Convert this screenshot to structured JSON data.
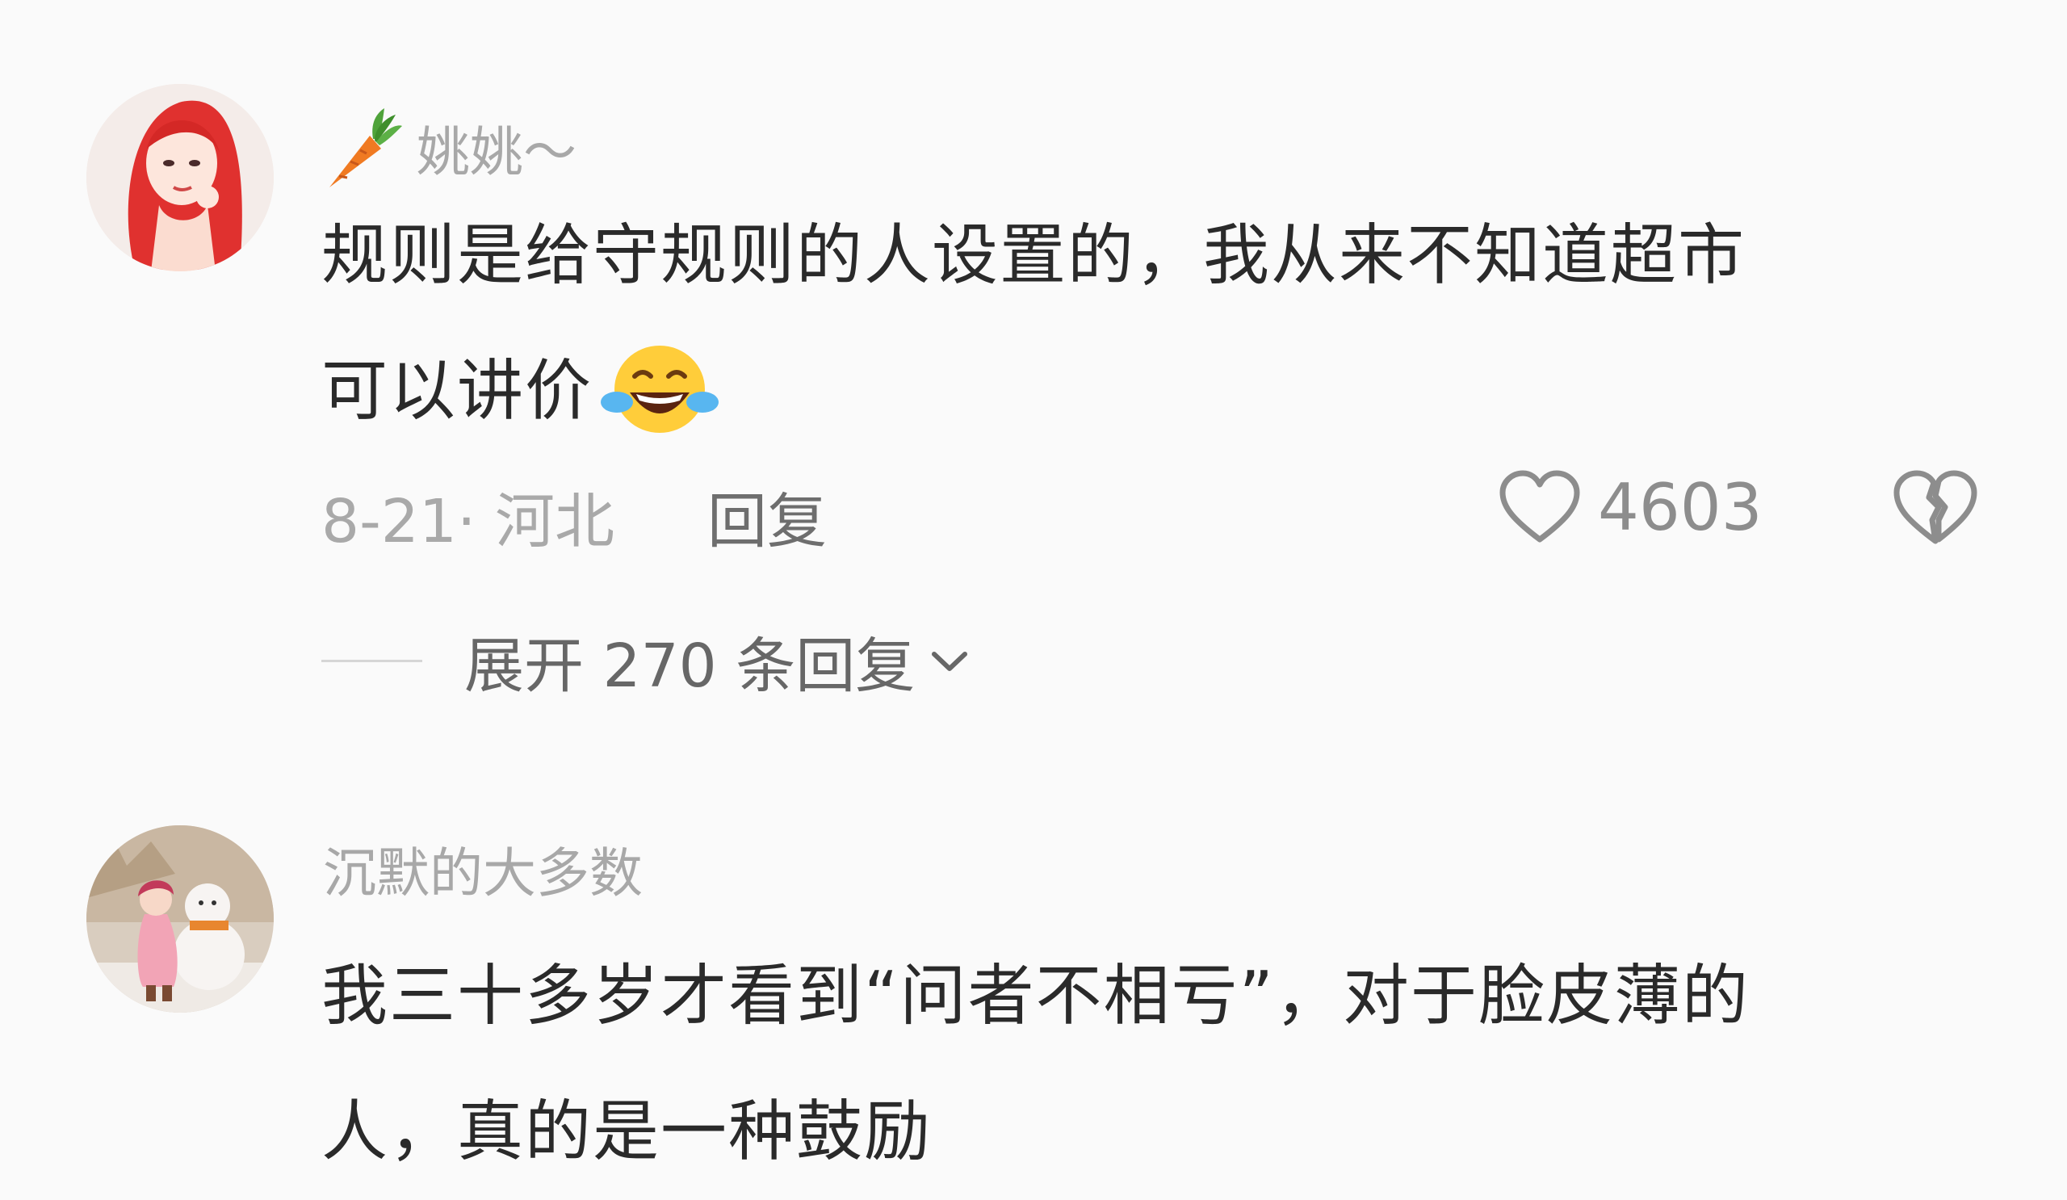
{
  "comments": [
    {
      "username": "姚姚～",
      "content_line1": "规则是给守规则的人设置的，我从来不知道超市",
      "content_line2": "可以讲价",
      "date_location": "8-21· 河北",
      "reply_label": "回复",
      "likes": "4603",
      "expand_label": "展开 270 条回复",
      "icons": [
        "carrot-icon",
        "laughing-crying-emoji",
        "heart-icon",
        "broken-heart-icon",
        "chevron-down-icon"
      ]
    },
    {
      "username": "沉默的大多数",
      "content_line1": "我三十多岁才看到“问者不相亏”，对于脸皮薄的",
      "content_line2": "人，真的是一种鼓励"
    }
  ],
  "colors": {
    "background": "#fafafa",
    "text": "#2a2a2a",
    "muted": "#a8a8a8",
    "accent_carrot": "#f07a22"
  }
}
